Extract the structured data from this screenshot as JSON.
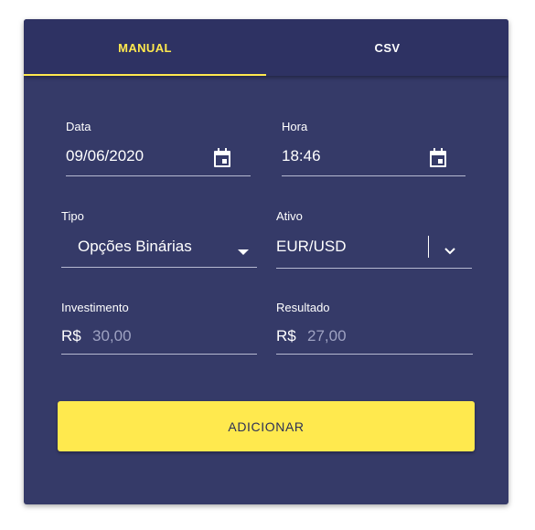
{
  "tabs": [
    {
      "label": "MANUAL",
      "active": true
    },
    {
      "label": "CSV",
      "active": false
    }
  ],
  "form": {
    "data": {
      "label": "Data",
      "value": "09/06/2020",
      "icon": "calendar-icon"
    },
    "hora": {
      "label": "Hora",
      "value": "18:46",
      "icon": "calendar-icon"
    },
    "tipo": {
      "label": "Tipo",
      "value": "Opções Binárias",
      "icon": "caret-down-icon"
    },
    "ativo": {
      "label": "Ativo",
      "value": "EUR/USD",
      "icon": "chevron-down-icon"
    },
    "investimento": {
      "label": "Investimento",
      "prefix": "R$",
      "placeholder": "30,00"
    },
    "resultado": {
      "label": "Resultado",
      "prefix": "R$",
      "placeholder": "27,00"
    }
  },
  "submit_label": "ADICIONAR",
  "colors": {
    "card": "#353a68",
    "tabbar": "#2e3263",
    "accent": "#ffe94e",
    "text": "#ffffff",
    "muted": "#9ea2c2"
  }
}
